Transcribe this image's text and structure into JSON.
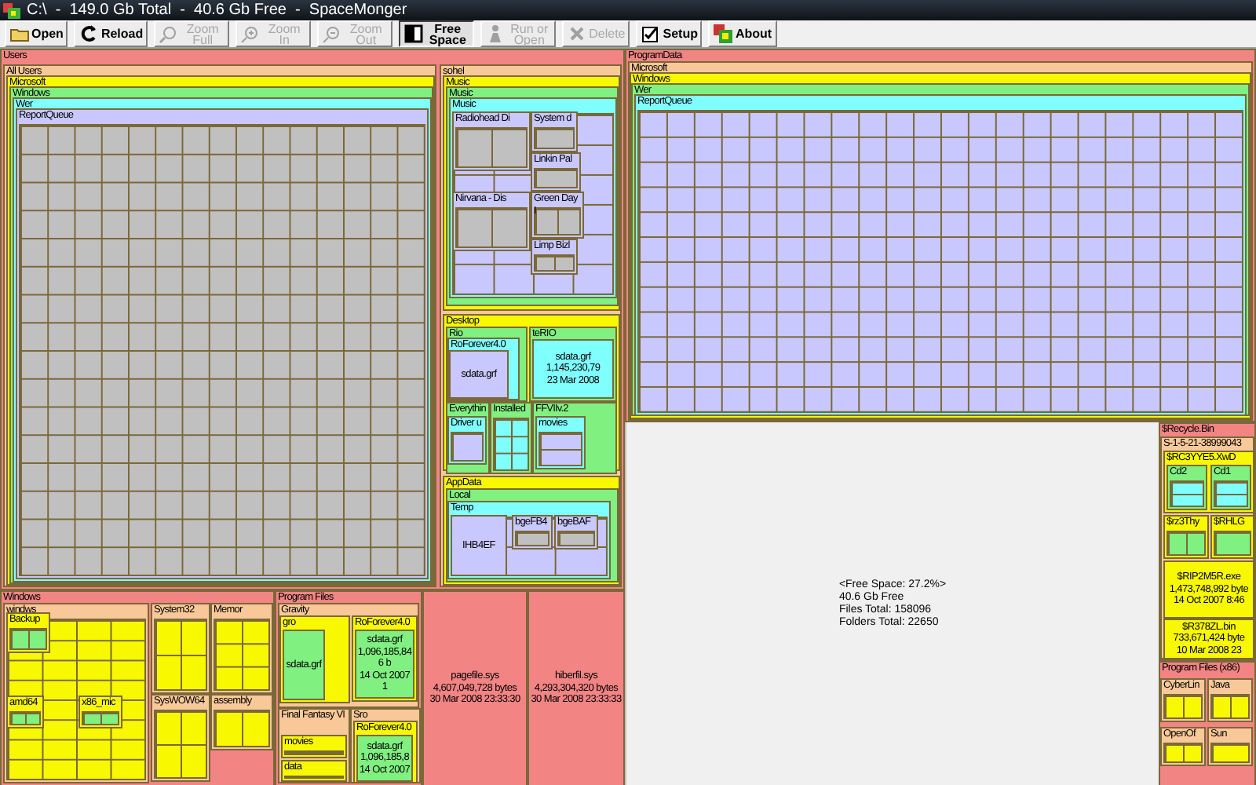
{
  "window": {
    "title": "C:\\  -  149.0 Gb Total  -  40.6 Gb Free  -  SpaceMonger"
  },
  "toolbar": [
    {
      "kind": "open",
      "label": "Open",
      "disabled": false,
      "pressed": false
    },
    {
      "kind": "reload",
      "label": "Reload",
      "disabled": false,
      "pressed": false
    },
    {
      "kind": "zoom-full",
      "label": "Zoom Full",
      "disabled": true,
      "pressed": false
    },
    {
      "kind": "zoom-in",
      "label": "Zoom In",
      "disabled": true,
      "pressed": false
    },
    {
      "kind": "zoom-out",
      "label": "Zoom Out",
      "disabled": true,
      "pressed": false
    },
    {
      "kind": "free-space",
      "label": "Free Space",
      "disabled": false,
      "pressed": true
    },
    {
      "kind": "run",
      "label": "Run or Open",
      "disabled": true,
      "pressed": false
    },
    {
      "kind": "delete",
      "label": "Delete",
      "disabled": true,
      "pressed": false
    },
    {
      "kind": "setup",
      "label": "Setup",
      "disabled": false,
      "pressed": false
    },
    {
      "kind": "about",
      "label": "About",
      "disabled": false,
      "pressed": false
    }
  ],
  "treemap": {
    "nodes": [
      {
        "kind": "folder",
        "label": "Users",
        "children": [
          {
            "kind": "folder",
            "label": "All Users",
            "children": [
              {
                "kind": "folder",
                "label": "Microsoft",
                "children": [
                  {
                    "kind": "folder",
                    "label": "Windows",
                    "children": [
                      {
                        "kind": "folder",
                        "label": "Wer",
                        "children": [
                          {
                            "kind": "folder",
                            "label": "ReportQueue"
                          }
                        ]
                      }
                    ]
                  }
                ]
              }
            ]
          },
          {
            "kind": "folder",
            "label": "sohel",
            "children": [
              {
                "kind": "folder",
                "label": "Music",
                "children": [
                  {
                    "kind": "folder",
                    "label": "Music",
                    "children": [
                      {
                        "kind": "folder",
                        "label": "Music",
                        "children": [
                          {
                            "kind": "folder",
                            "label": "Radiohead Di"
                          },
                          {
                            "kind": "folder",
                            "label": "System d"
                          },
                          {
                            "kind": "folder",
                            "label": "Linkin Pal"
                          },
                          {
                            "kind": "folder",
                            "label": "Nirvana - Dis"
                          },
                          {
                            "kind": "folder",
                            "label": "Green Day I"
                          },
                          {
                            "kind": "folder",
                            "label": "Limp Bizl"
                          }
                        ]
                      }
                    ]
                  }
                ]
              },
              {
                "kind": "folder",
                "label": "Desktop",
                "children": [
                  {
                    "kind": "folder",
                    "label": "Rio",
                    "children": [
                      {
                        "kind": "folder",
                        "label": "RoForever4.0",
                        "children": [
                          {
                            "kind": "file",
                            "label": "sdata.grf"
                          }
                        ]
                      }
                    ]
                  },
                  {
                    "kind": "folder",
                    "label": "teRIO",
                    "children": [
                      {
                        "kind": "file",
                        "label": "sdata.grf",
                        "lines": [
                          "1,145,230,79",
                          "23 Mar 2008"
                        ]
                      }
                    ]
                  },
                  {
                    "kind": "folder",
                    "label": "Everythin",
                    "children": [
                      {
                        "kind": "folder",
                        "label": "Driver u"
                      }
                    ]
                  },
                  {
                    "kind": "folder",
                    "label": "Installed"
                  },
                  {
                    "kind": "folder",
                    "label": "FFVIIv.2",
                    "children": [
                      {
                        "kind": "folder",
                        "label": "movies"
                      }
                    ]
                  }
                ]
              },
              {
                "kind": "folder",
                "label": "AppData",
                "children": [
                  {
                    "kind": "folder",
                    "label": "Local",
                    "children": [
                      {
                        "kind": "folder",
                        "label": "Temp",
                        "children": [
                          {
                            "kind": "file",
                            "label": "IHB4EF"
                          },
                          {
                            "kind": "folder",
                            "label": "bgeFB4"
                          },
                          {
                            "kind": "folder",
                            "label": "bgeBAF"
                          }
                        ]
                      }
                    ]
                  }
                ]
              }
            ]
          }
        ]
      },
      {
        "kind": "folder",
        "label": "Windows",
        "children": [
          {
            "kind": "folder",
            "label": "windws",
            "children": [
              {
                "kind": "folder",
                "label": "Backup"
              },
              {
                "kind": "folder",
                "label": "amd64"
              },
              {
                "kind": "folder",
                "label": "x86_mic"
              }
            ]
          },
          {
            "kind": "folder",
            "label": "System32"
          },
          {
            "kind": "folder",
            "label": "Memor"
          },
          {
            "kind": "folder",
            "label": "SysWOW64"
          },
          {
            "kind": "folder",
            "label": "assembly"
          }
        ]
      },
      {
        "kind": "folder",
        "label": "Program Files",
        "children": [
          {
            "kind": "folder",
            "label": "Gravity",
            "children": [
              {
                "kind": "folder",
                "label": "gro",
                "children": [
                  {
                    "kind": "file",
                    "label": "sdata.grf"
                  }
                ]
              },
              {
                "kind": "folder",
                "label": "RoForever4.0",
                "children": [
                  {
                    "kind": "file",
                    "label": "sdata.grf",
                    "lines": [
                      "1,096,185,846 b",
                      "14 Oct 2007  1"
                    ]
                  }
                ]
              }
            ]
          },
          {
            "kind": "folder",
            "label": "Final Fantasy VI",
            "children": [
              {
                "kind": "folder",
                "label": "movies"
              },
              {
                "kind": "folder",
                "label": "data"
              }
            ]
          },
          {
            "kind": "folder",
            "label": "Sro",
            "children": [
              {
                "kind": "folder",
                "label": "RoForever4.0",
                "children": [
                  {
                    "kind": "file",
                    "label": "sdata.grf",
                    "lines": [
                      "1,096,185,8",
                      "14 Oct 2007"
                    ]
                  }
                ]
              }
            ]
          }
        ]
      },
      {
        "kind": "file",
        "label": "pagefile.sys",
        "lines": [
          "4,607,049,728 bytes",
          "30 Mar 2008   23:33:30"
        ]
      },
      {
        "kind": "file",
        "label": "hiberfil.sys",
        "lines": [
          "4,293,304,320 bytes",
          "30 Mar 2008   23:33:33"
        ]
      },
      {
        "kind": "folder",
        "label": "ProgramData",
        "children": [
          {
            "kind": "folder",
            "label": "Microsoft",
            "children": [
              {
                "kind": "folder",
                "label": "Windows",
                "children": [
                  {
                    "kind": "folder",
                    "label": "Wer",
                    "children": [
                      {
                        "kind": "folder",
                        "label": "ReportQueue"
                      }
                    ]
                  }
                ]
              }
            ]
          }
        ]
      },
      {
        "kind": "free",
        "label": "<Free Space: 27.2%>",
        "lines": [
          "40.6 Gb Free",
          "Files Total:  158096",
          "Folders Total:  22650"
        ]
      },
      {
        "kind": "folder",
        "label": "$Recycle.Bin",
        "children": [
          {
            "kind": "folder",
            "label": "S-1-5-21-38999043",
            "children": [
              {
                "kind": "folder",
                "label": "$RC3YYE5.XwD",
                "children": [
                  {
                    "kind": "folder",
                    "label": "Cd2"
                  },
                  {
                    "kind": "folder",
                    "label": "Cd1"
                  }
                ]
              },
              {
                "kind": "folder",
                "label": "$rz3Thy"
              },
              {
                "kind": "folder",
                "label": "$RHLG"
              },
              {
                "kind": "file",
                "label": "$RIP2M5R.exe",
                "lines": [
                  "1,473,748,992 byte",
                  "14 Oct 2007  8:46"
                ]
              },
              {
                "kind": "file",
                "label": "$R378ZL.bin",
                "lines": [
                  "733,671,424 byte",
                  "10 Mar 2008  23"
                ]
              }
            ]
          }
        ]
      },
      {
        "kind": "folder",
        "label": "Program Files (x86)",
        "children": [
          {
            "kind": "folder",
            "label": "CyberLin"
          },
          {
            "kind": "folder",
            "label": "Java"
          },
          {
            "kind": "folder",
            "label": "OpenOf"
          },
          {
            "kind": "folder",
            "label": "Sun"
          }
        ]
      }
    ]
  }
}
